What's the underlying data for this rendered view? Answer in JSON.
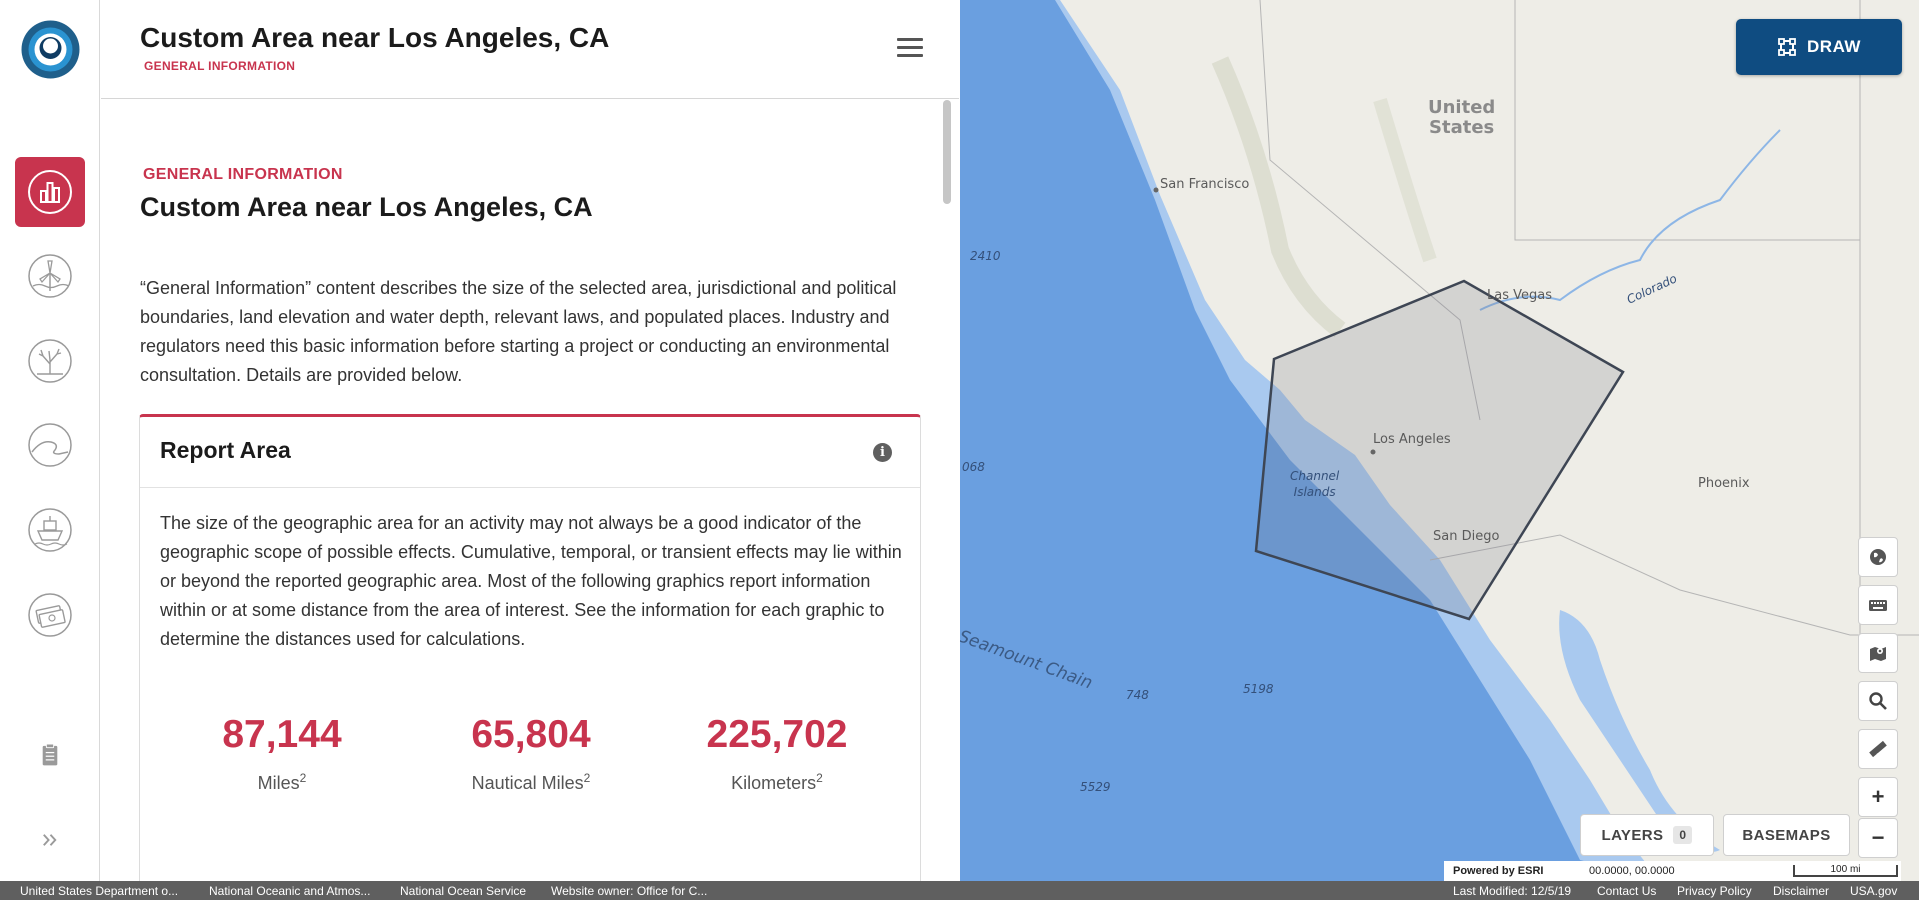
{
  "header": {
    "title": "Custom Area near Los Angeles, CA",
    "subtitle": "GENERAL INFORMATION"
  },
  "rail": {
    "items": [
      {
        "name": "general-info",
        "icon": "bar-chart-icon",
        "active": true
      },
      {
        "name": "energy",
        "icon": "wind-turbine-icon",
        "active": false
      },
      {
        "name": "ecology",
        "icon": "coral-icon",
        "active": false
      },
      {
        "name": "hazards",
        "icon": "wave-icon",
        "active": false
      },
      {
        "name": "transportation",
        "icon": "ship-icon",
        "active": false
      },
      {
        "name": "economics",
        "icon": "money-icon",
        "active": false
      }
    ],
    "report_icon": "clipboard-icon",
    "expand_icon": "double-chevron-right-icon"
  },
  "main": {
    "section_label": "GENERAL INFORMATION",
    "section_title": "Custom Area near Los Angeles, CA",
    "intro": "“General Information” content describes the size of the selected area, jurisdictional and political boundaries, land elevation and water depth, relevant laws, and populated places. Industry and regulators need this basic information before starting a project or conducting an environmental consultation. Details are provided below.",
    "card": {
      "title": "Report Area",
      "body": "The size of the geographic area for an activity may not always be a good indicator of the geographic scope of possible effects. Cumulative, temporal, or transient effects may lie within or beyond the reported geographic area. Most of the following graphics report information within or at some distance from the area of interest. See the information for each graphic to determine the distances used for calculations.",
      "stats": [
        {
          "value": "87,144",
          "unit": "Miles",
          "sup": "2"
        },
        {
          "value": "65,804",
          "unit": "Nautical Miles",
          "sup": "2"
        },
        {
          "value": "225,702",
          "unit": "Kilometers",
          "sup": "2"
        }
      ]
    }
  },
  "map": {
    "draw_label": "DRAW",
    "layers_label": "LAYERS",
    "layers_count": "0",
    "basemaps_label": "BASEMAPS",
    "labels": {
      "country": "United\nStates",
      "sf": "San Francisco",
      "lv": "Las Vegas",
      "colorado": "Colorado",
      "la": "Los Angeles",
      "channel": "Channel\nIslands",
      "sd": "San Diego",
      "phoenix": "Phoenix",
      "seamount": "Seamount Chain",
      "d2410": "2410",
      "d068": "068",
      "d748": "748",
      "d5198": "5198",
      "d5529": "5529"
    },
    "attribution": {
      "powered": "Powered by ESRI",
      "coords": "00.0000, 00.0000",
      "scale": "100 mi"
    },
    "tools": [
      "globe-icon",
      "keyboard-icon",
      "map-marker-icon",
      "search-icon",
      "ruler-icon",
      "zoom-in-icon",
      "zoom-out-icon"
    ],
    "colors": {
      "ocean": "#6a9fe0",
      "land": "#eeede7",
      "shelf": "#a9c9ef",
      "polygon": "#3e4654"
    }
  },
  "footer": {
    "links": [
      "United States Department o...",
      "National Oceanic and Atmos...",
      "National Ocean Service",
      "Website owner: Office for C..."
    ],
    "right": [
      "Last Modified: 12/5/19",
      "Contact Us",
      "Privacy Policy",
      "Disclaimer",
      "USA.gov"
    ]
  }
}
